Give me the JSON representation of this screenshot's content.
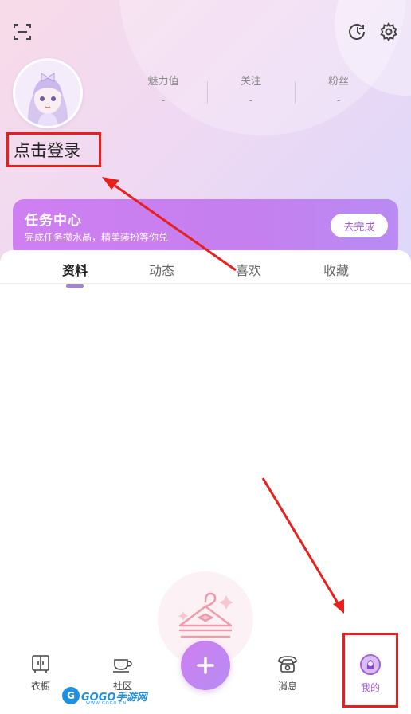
{
  "header": {
    "scan_icon": "scan-icon",
    "history_icon": "history-icon",
    "settings_icon": "gear-icon"
  },
  "profile": {
    "login_text": "点击登录",
    "stats": [
      {
        "label": "魅力值",
        "value": "-"
      },
      {
        "label": "关注",
        "value": "-"
      },
      {
        "label": "粉丝",
        "value": "-"
      }
    ]
  },
  "task_center": {
    "title": "任务中心",
    "subtitle": "完成任务攒水晶，精美装扮等你兑",
    "button": "去完成"
  },
  "tabs": [
    "资料",
    "动态",
    "喜欢",
    "收藏"
  ],
  "active_tab": "资料",
  "tabbar": {
    "items": [
      {
        "label": "衣橱",
        "icon": "wardrobe-icon"
      },
      {
        "label": "社区",
        "icon": "cup-icon"
      },
      {
        "label": "消息",
        "icon": "telephone-icon"
      },
      {
        "label": "我的",
        "icon": "avatar-icon"
      }
    ],
    "plus_icon": "plus-icon"
  },
  "watermark": {
    "text": "GOGO手游网",
    "sub": "WWW.GOGO.CN"
  },
  "colors": {
    "accent": "#a45fd9",
    "annotation": "#e8201c",
    "task_gradient_start": "#cf7ff2",
    "task_gradient_end": "#b98bf3"
  }
}
